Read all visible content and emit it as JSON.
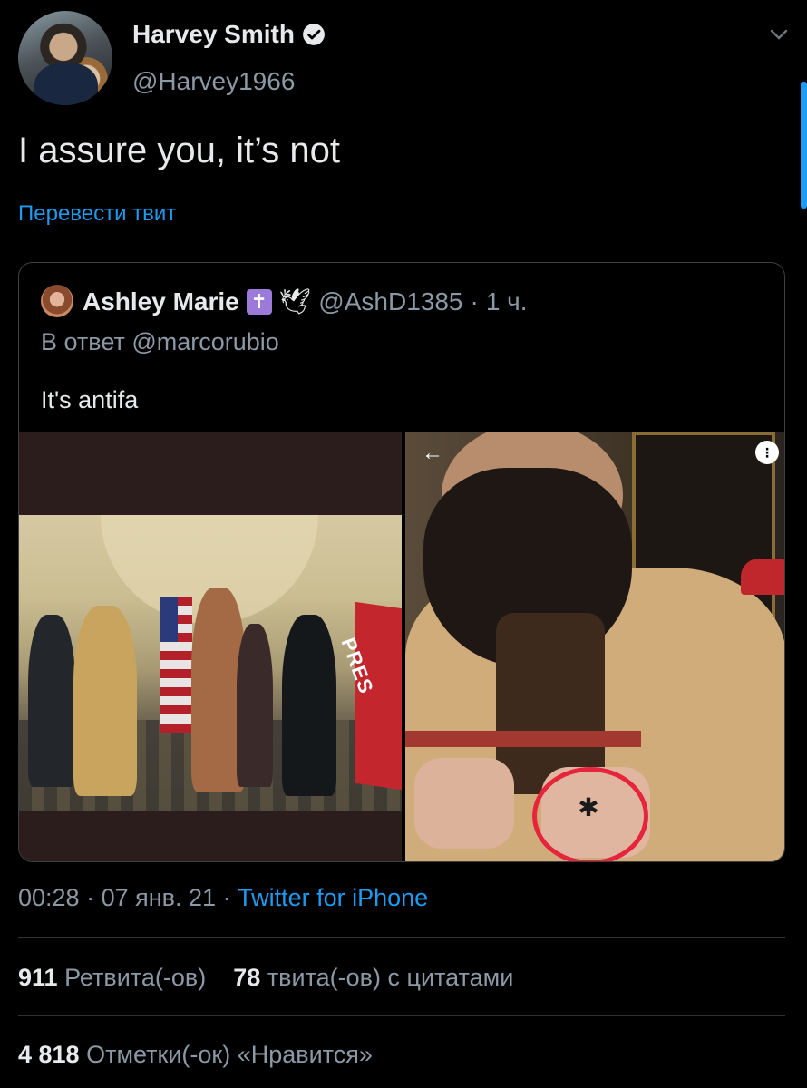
{
  "author": {
    "display_name": "Harvey Smith",
    "handle": "@Harvey1966",
    "verified": true,
    "avatar_icon": "avatar-photo"
  },
  "tweet": {
    "text": "I assure you, it’s not",
    "translate_label": "Перевести твит"
  },
  "quoted_tweet": {
    "display_name": "Ashley Marie",
    "badge_cross": "✝",
    "badge_dove": "🕊",
    "handle": "@AshD1385",
    "separator": "·",
    "time": "1 ч.",
    "reply_prefix": "В ответ",
    "reply_to": "@marcorubio",
    "text": "It's antifa",
    "media_right_back_icon": "←",
    "media_right_more_icon": "⋮",
    "banner_text": "PRES"
  },
  "meta": {
    "time": "00:28",
    "sep1": "·",
    "date": "07 янв. 21",
    "sep2": "·",
    "source": "Twitter for iPhone"
  },
  "stats": {
    "retweets_count": "911",
    "retweets_label": "Ретвита(-ов)",
    "quotes_count": "78",
    "quotes_label": "твита(-ов) с цитатами",
    "likes_count": "4 818",
    "likes_label": "Отметки(-ок) «Нравится»"
  },
  "colors": {
    "background": "#000000",
    "link": "#1d9bf0",
    "muted": "#8b98a5",
    "text": "#e7e9ea"
  }
}
